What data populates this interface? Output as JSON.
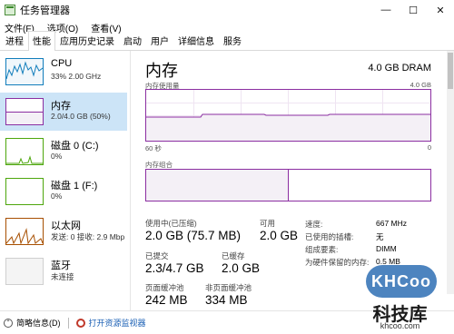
{
  "window": {
    "title": "任务管理器",
    "controls": [
      "—",
      "☐",
      "✕"
    ]
  },
  "menu": [
    "文件(F)",
    "选项(O)",
    "查看(V)"
  ],
  "tabs": [
    "进程",
    "性能",
    "应用历史记录",
    "启动",
    "用户",
    "详细信息",
    "服务"
  ],
  "active_tab": "性能",
  "sidebar": [
    {
      "name": "CPU",
      "sub": "33% 2.00 GHz",
      "color": "#117dbb"
    },
    {
      "name": "内存",
      "sub": "2.0/4.0 GB (50%)",
      "color": "#8b2ea1"
    },
    {
      "name": "磁盘 0 (C:)",
      "sub": "0%",
      "color": "#4da60c"
    },
    {
      "name": "磁盘 1 (F:)",
      "sub": "0%",
      "color": "#4da60c"
    },
    {
      "name": "以太网",
      "sub": "发送: 0 接收: 2.9 Mbp",
      "color": "#a74f01"
    },
    {
      "name": "蓝牙",
      "sub": "未连接",
      "color": "#a0a0a0"
    }
  ],
  "memory": {
    "title": "内存",
    "total": "4.0 GB DRAM",
    "usage_label": "内存使用量",
    "usage_max": "4.0 GB",
    "time_left": "60 秒",
    "time_right": "0",
    "composition_label": "内存组合",
    "in_use_fraction": 0.5,
    "stats": {
      "in_use_label": "使用中(已压缩)",
      "in_use_value": "2.0 GB (75.7 MB)",
      "available_label": "可用",
      "available_value": "2.0 GB",
      "committed_label": "已提交",
      "committed_value": "2.3/4.7 GB",
      "cached_label": "已缓存",
      "cached_value": "2.0 GB",
      "paged_label": "页面缓冲池",
      "paged_value": "242 MB",
      "nonpaged_label": "非页面缓冲池",
      "nonpaged_value": "334 MB"
    },
    "details": [
      {
        "label": "速度:",
        "value": "667 MHz"
      },
      {
        "label": "已使用的插槽:",
        "value": "无"
      },
      {
        "label": "组成要素:",
        "value": "DIMM"
      },
      {
        "label": "为硬件保留的内存:",
        "value": "0.5 MB"
      }
    ]
  },
  "footer": {
    "summary": "简略信息(D)",
    "monitor": "打开资源监视器"
  },
  "watermark": {
    "badge": "KHCoo",
    "cn": "科技库",
    "url": "khcoo.com"
  }
}
